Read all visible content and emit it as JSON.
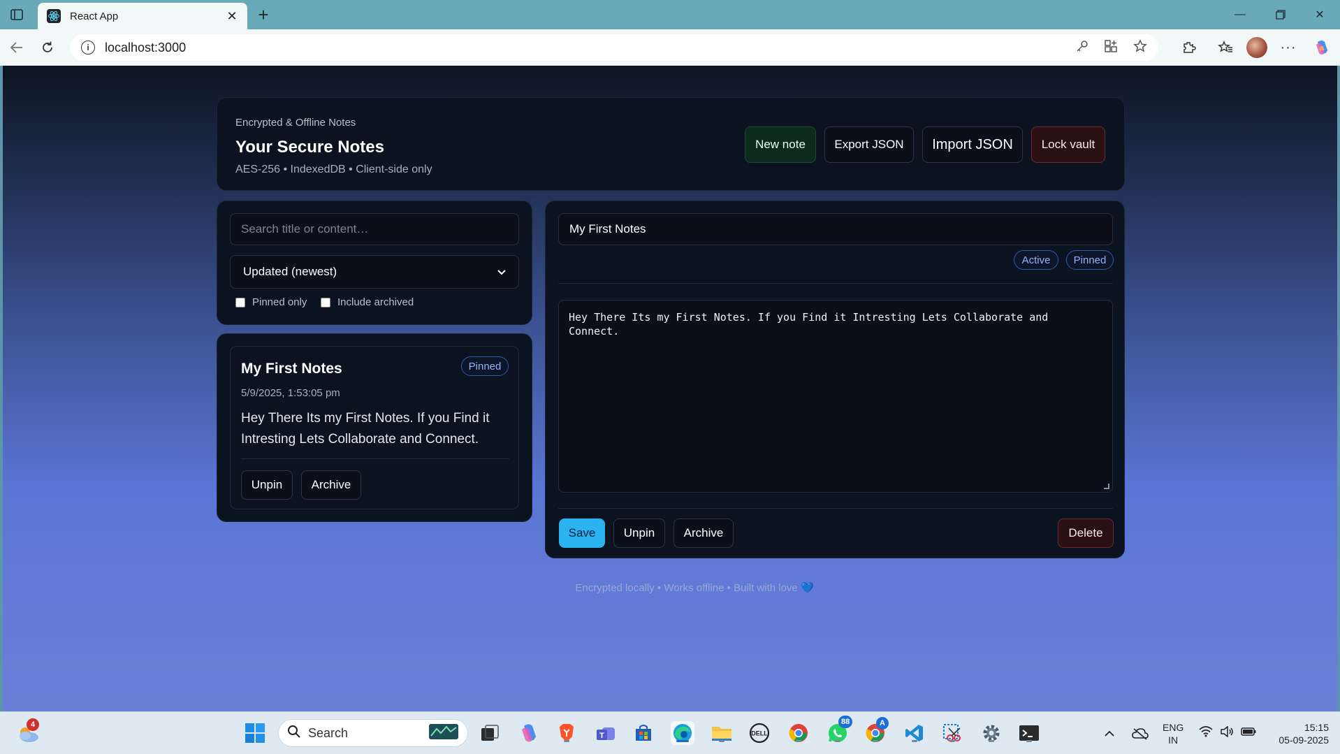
{
  "browser": {
    "tab_title": "React App",
    "url": "localhost:3000"
  },
  "header": {
    "eyebrow": "Encrypted & Offline Notes",
    "title": "Your Secure Notes",
    "subtitle": "AES-256 • IndexedDB • Client-side only",
    "buttons": {
      "new_note": "New note",
      "export": "Export JSON",
      "import": "Import JSON",
      "lock": "Lock vault"
    }
  },
  "filters": {
    "search_placeholder": "Search title or content…",
    "sort_value": "Updated (newest)",
    "pinned_only_label": "Pinned only",
    "pinned_only_checked": false,
    "include_archived_label": "Include archived",
    "include_archived_checked": false
  },
  "notes": [
    {
      "title": "My First Notes",
      "badge": "Pinned",
      "date": "5/9/2025, 1:53:05 pm",
      "preview": "Hey There Its my First Notes. If you Find it Intresting Lets Collaborate and Connect.",
      "unpin_label": "Unpin",
      "archive_label": "Archive"
    }
  ],
  "editor": {
    "title": "My First Notes",
    "status_badge": "Active",
    "pinned_badge": "Pinned",
    "content": "Hey There Its my First Notes. If you Find it Intresting Lets Collaborate and Connect.",
    "save_label": "Save",
    "unpin_label": "Unpin",
    "archive_label": "Archive",
    "delete_label": "Delete"
  },
  "footer": {
    "text": "Encrypted locally • Works offline • Built with love 💙"
  },
  "taskbar": {
    "weather_badge": "4",
    "search_label": "Search",
    "whatsapp_badge": "88",
    "chrome_profile_badge": "A",
    "language_top": "ENG",
    "language_bottom": "IN",
    "time": "15:15",
    "date": "05-09-2025"
  },
  "colors": {
    "accent": "#2bb2f0",
    "danger_bg": "#2a0f14",
    "success_bg": "#0c2a1e",
    "card_bg": "#0b1220",
    "pill_text": "#8fb4ff"
  }
}
